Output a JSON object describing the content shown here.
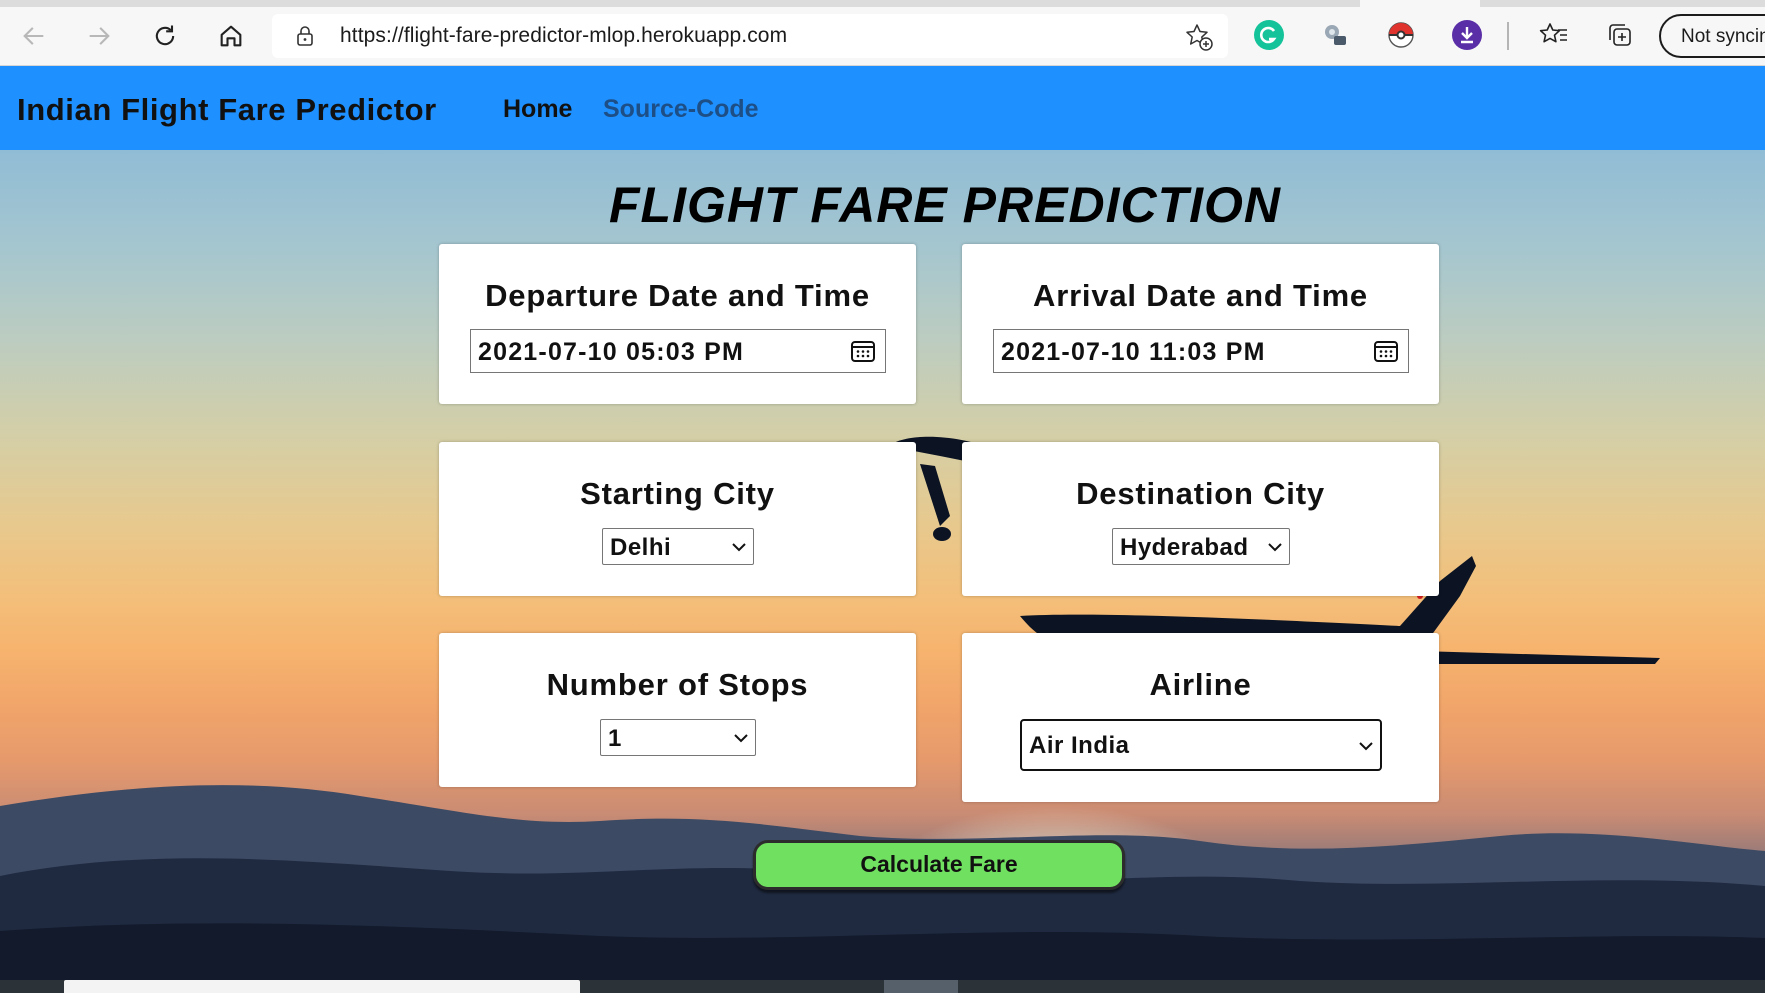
{
  "browser": {
    "url": "https://flight-fare-predictor-mlop.herokuapp.com",
    "sync_label": "Not syncing",
    "icons": [
      "back-icon",
      "forward-icon",
      "refresh-icon",
      "home-icon",
      "lock-icon",
      "add-favorite-icon",
      "grammarly-icon",
      "extension-icon",
      "pokeball-icon",
      "download-icon",
      "favorites-icon",
      "collections-icon"
    ]
  },
  "navbar": {
    "brand": "Indian Flight Fare Predictor",
    "links": [
      {
        "label": "Home"
      },
      {
        "label": "Source-Code"
      }
    ]
  },
  "main": {
    "title": "FLIGHT FARE PREDICTION",
    "departure": {
      "label": "Departure Date and Time",
      "value": "2021-07-10 05:03 PM"
    },
    "arrival": {
      "label": "Arrival Date and Time",
      "value": "2021-07-10 11:03 PM"
    },
    "source": {
      "label": "Starting City",
      "value": "Delhi"
    },
    "destination": {
      "label": "Destination City",
      "value": "Hyderabad"
    },
    "stops": {
      "label": "Number of Stops",
      "value": "1"
    },
    "airline": {
      "label": "Airline",
      "value": "Air India"
    },
    "submit_label": "Calculate Fare"
  },
  "colors": {
    "navbar": "#1e90ff",
    "button": "#70e060",
    "source_link": "#1d4f86"
  }
}
